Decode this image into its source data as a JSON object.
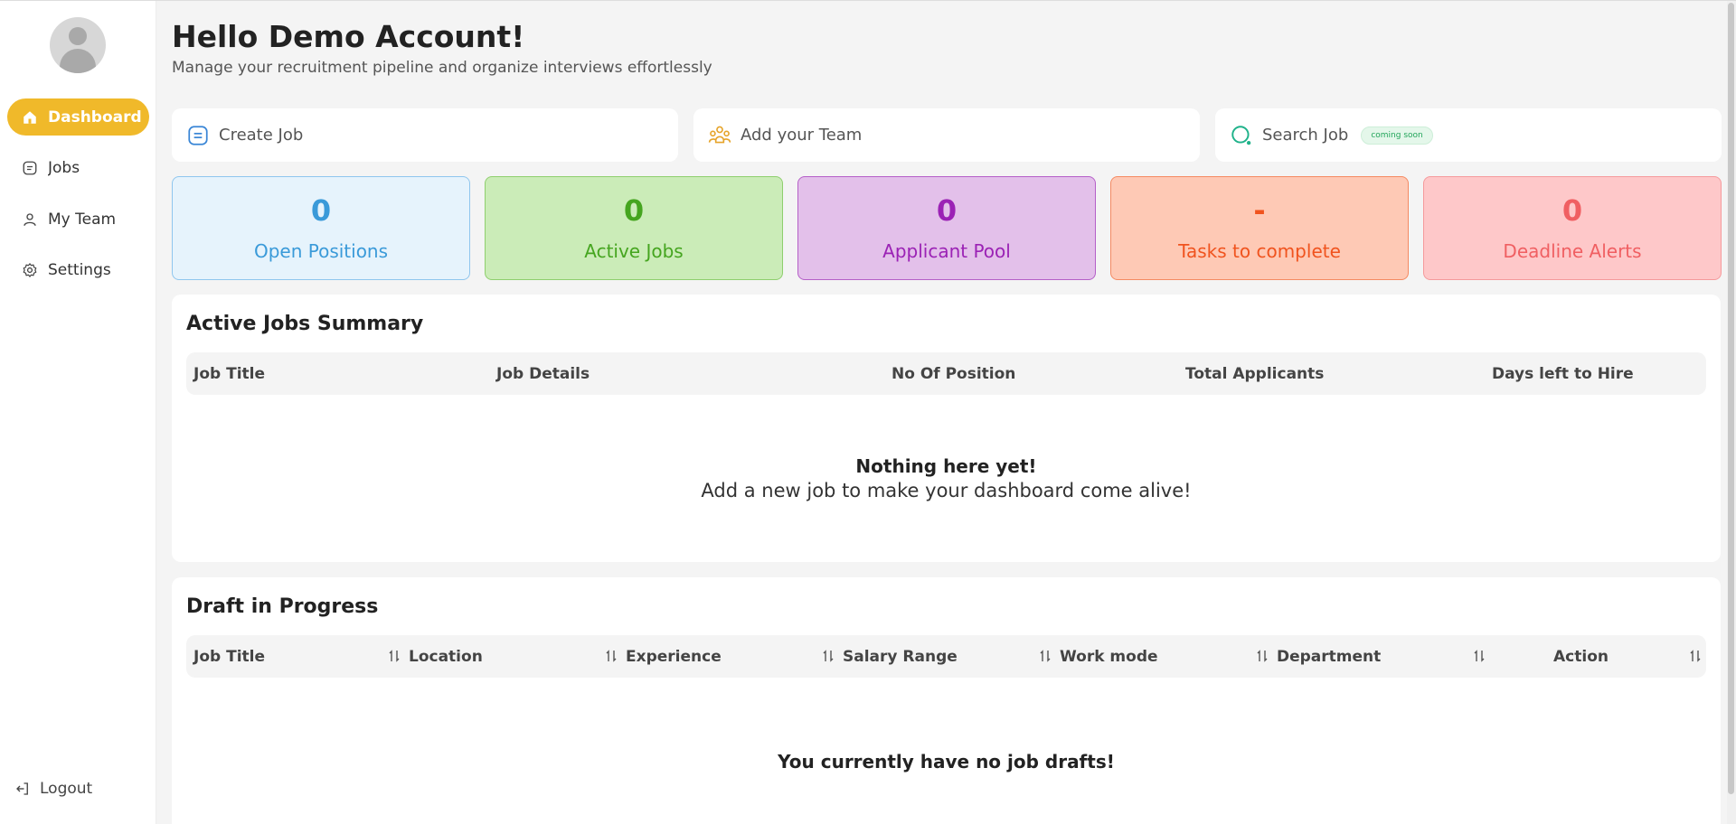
{
  "sidebar": {
    "items": [
      {
        "label": "Dashboard",
        "icon": "home-icon",
        "active": true
      },
      {
        "label": "Jobs",
        "icon": "document-icon",
        "active": false
      },
      {
        "label": "My Team",
        "icon": "user-icon",
        "active": false
      },
      {
        "label": "Settings",
        "icon": "gear-icon",
        "active": false
      }
    ],
    "logout_label": "Logout"
  },
  "header": {
    "title": "Hello Demo Account!",
    "subtitle": "Manage your recruitment pipeline and organize interviews effortlessly"
  },
  "actions": {
    "create_job": "Create Job",
    "add_team": "Add your Team",
    "search_job": "Search Job",
    "search_badge": "coming soon"
  },
  "stats": [
    {
      "value": "0",
      "label": "Open Positions",
      "color": "#3a9ad9",
      "bg": "#e6f3fc",
      "border": "#8fc6ee"
    },
    {
      "value": "0",
      "label": "Active Jobs",
      "color": "#45a51f",
      "bg": "#cbecb8",
      "border": "#8fcf6e"
    },
    {
      "value": "0",
      "label": "Applicant Pool",
      "color": "#9b22b5",
      "bg": "#e3c0ea",
      "border": "#b55fc8"
    },
    {
      "value": "-",
      "label": "Tasks to complete",
      "color": "#f0531e",
      "bg": "#fec9b5",
      "border": "#f58a62"
    },
    {
      "value": "0",
      "label": "Deadline Alerts",
      "color": "#f05f62",
      "bg": "#fec8c9",
      "border": "#f59a9c"
    }
  ],
  "active_jobs": {
    "title": "Active Jobs Summary",
    "columns": [
      "Job Title",
      "Job Details",
      "No Of Position",
      "Total Applicants",
      "Days left to Hire"
    ],
    "empty_title": "Nothing here yet!",
    "empty_sub": "Add a new job to make your dashboard come alive!"
  },
  "drafts": {
    "title": "Draft in Progress",
    "columns": [
      "Job Title",
      "Location",
      "Experience",
      "Salary Range",
      "Work mode",
      "Department",
      "Action"
    ],
    "empty_title": "You currently have no job drafts!"
  }
}
